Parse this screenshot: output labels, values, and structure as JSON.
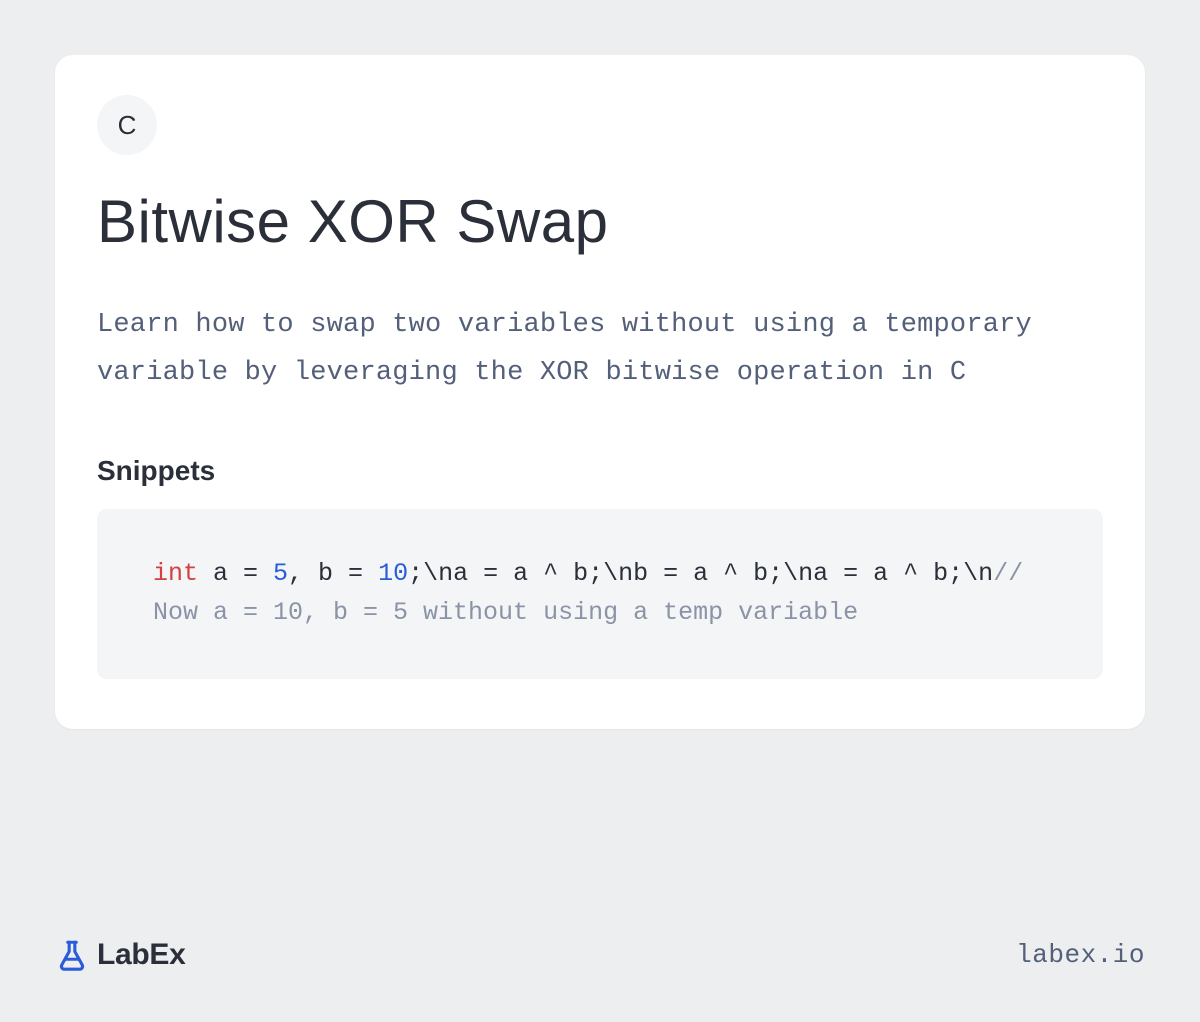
{
  "lang_badge": "C",
  "title": "Bitwise XOR Swap",
  "description": "Learn how to swap two variables without using a temporary variable by leveraging the XOR bitwise operation in C",
  "section_heading": "Snippets",
  "code": {
    "tokens": [
      {
        "t": "int",
        "cls": "kw"
      },
      {
        "t": " a = "
      },
      {
        "t": "5",
        "cls": "num"
      },
      {
        "t": ", b = "
      },
      {
        "t": "10",
        "cls": "num"
      },
      {
        "t": ";\\na = a ^ b;\\nb = a ^ b;\\na = a ^ b;\\n"
      },
      {
        "t": "// Now a = 10, b = 5 without using a temp variable",
        "cls": "cmt"
      }
    ]
  },
  "brand_name": "LabEx",
  "site": "labex.io"
}
